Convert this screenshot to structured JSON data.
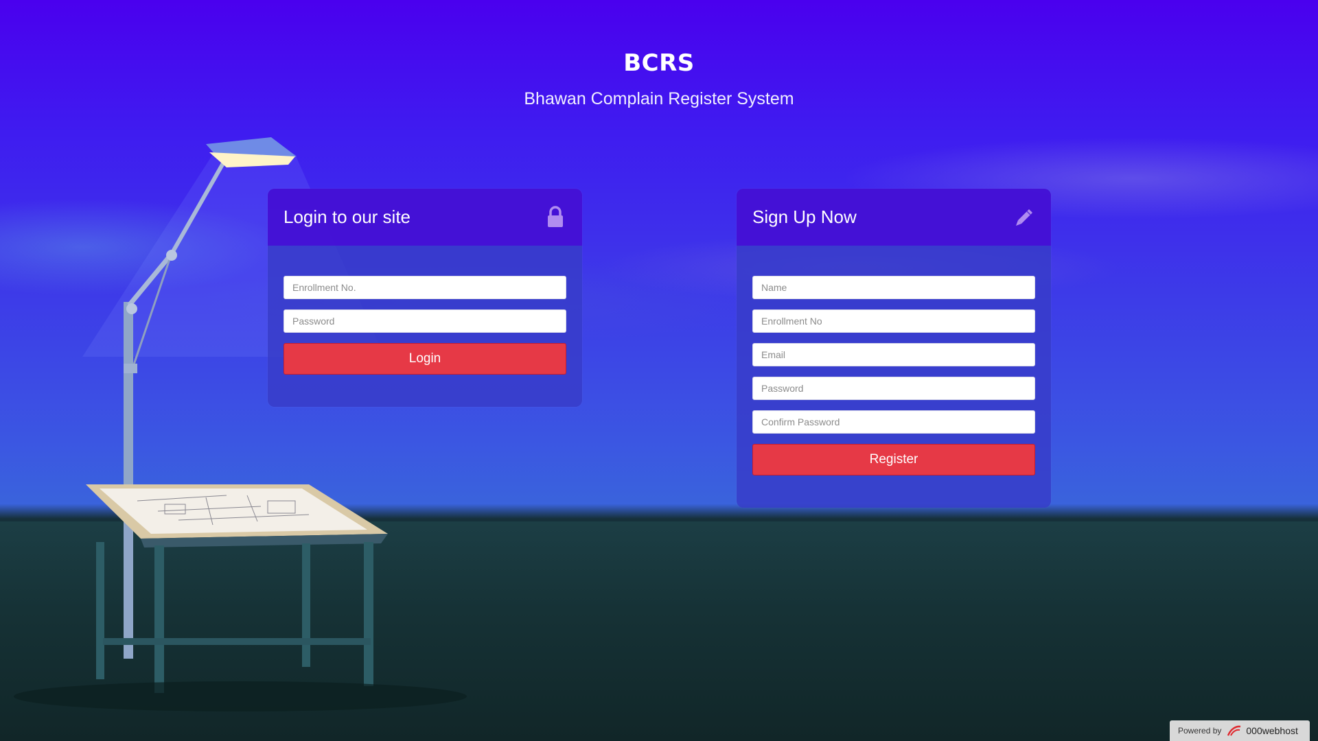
{
  "header": {
    "brand": "BCRS",
    "subtitle": "Bhawan Complain Register System"
  },
  "login": {
    "title": "Login to our site",
    "icon": "lock-icon",
    "enrollment_placeholder": "Enrollment No.",
    "password_placeholder": "Password",
    "submit_label": "Login"
  },
  "signup": {
    "title": "Sign Up Now",
    "icon": "pencil-icon",
    "name_placeholder": "Name",
    "enrollment_placeholder": "Enrollment No",
    "email_placeholder": "Email",
    "password_placeholder": "Password",
    "confirm_placeholder": "Confirm Password",
    "submit_label": "Register"
  },
  "footer": {
    "powered_label": "Powered by",
    "host_name": "000webhost"
  },
  "colors": {
    "button": "#e63946",
    "panel_header": "#460ad7",
    "panel_body": "#373cc8",
    "sky_top": "#4a00ee"
  }
}
